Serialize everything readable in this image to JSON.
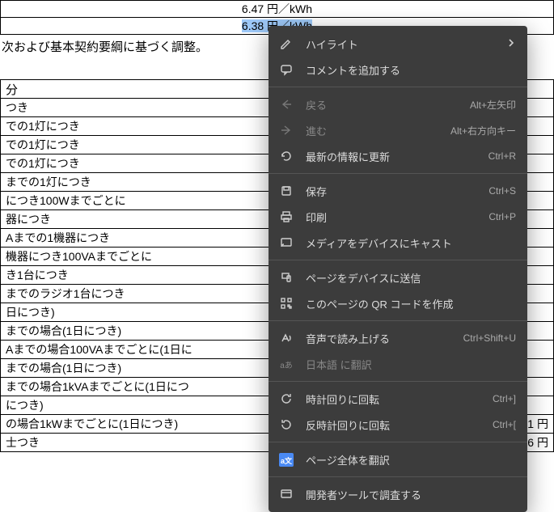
{
  "top_rates": {
    "r1": "6.47 円／kWh",
    "r2": "6.38 円／kWh"
  },
  "note_text": "次および基本契約要綱に基づく調整。",
  "table_header": "分",
  "table_rows": [
    "つき",
    "での1灯につき",
    "での1灯につき",
    "での1灯につき",
    "までの1灯につき",
    "につき100Wまでごとに",
    "器につき",
    "Aまでの1機器につき",
    "機器につき100VAまでごとに",
    "き1台につき",
    "までのラジオ1台につき",
    "日につき)",
    "までの場合(1日につき)",
    "Aまでの場合100VAまでごとに(1日に",
    "までの場合(1日につき)",
    "までの場合1kVAまでごとに(1日につ",
    "につき)",
    "の場合1kWまでごとに(1日につき)",
    "⼠つき"
  ],
  "price_vals": {
    "p1": "35.31 円",
    "p2": "31.76 円"
  },
  "menu": {
    "highlight": {
      "label": "ハイライト"
    },
    "comment": {
      "label": "コメントを追加する"
    },
    "back": {
      "label": "戻る",
      "kb": "Alt+左矢印"
    },
    "forward": {
      "label": "進む",
      "kb": "Alt+右方向キー"
    },
    "reload": {
      "label": "最新の情報に更新",
      "kb": "Ctrl+R"
    },
    "save": {
      "label": "保存",
      "kb": "Ctrl+S"
    },
    "print": {
      "label": "印刷",
      "kb": "Ctrl+P"
    },
    "cast": {
      "label": "メディアをデバイスにキャスト"
    },
    "send": {
      "label": "ページをデバイスに送信"
    },
    "qr": {
      "label": "このページの QR コードを作成"
    },
    "readaloud": {
      "label": "音声で読み上げる",
      "kb": "Ctrl+Shift+U"
    },
    "translate": {
      "label": "日本語 に翻訳"
    },
    "rot_cw": {
      "label": "時計回りに回転",
      "kb": "Ctrl+]"
    },
    "rot_ccw": {
      "label": "反時計回りに回転",
      "kb": "Ctrl+["
    },
    "translate_page": {
      "label": "ページ全体を翻訳"
    },
    "devtools": {
      "label": "開発者ツールで調査する"
    }
  }
}
